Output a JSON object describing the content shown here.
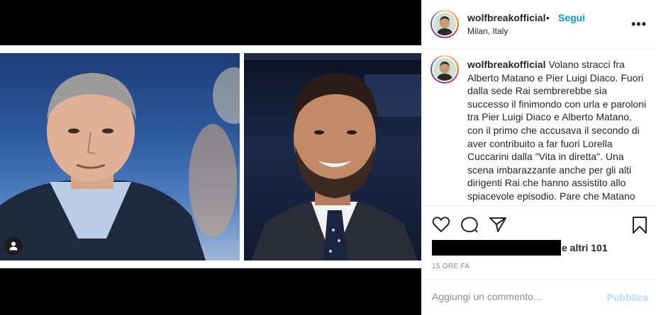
{
  "post": {
    "username": "wolfbreakofficial",
    "separator": "•",
    "follow_label": "Segui",
    "location": "Milan, Italy",
    "more_icon": "more-horizontal-icon",
    "caption_text": "Volano stracci fra Alberto Matano e Pier Luigi Diaco. Fuori dalla sede Rai sembrerebbe sia successo il finimondo con urla e paroloni tra Pier Luigi Diaco e Alberto Matano, con il primo che accusava il secondo di aver contribuito a far fuori Lorella Cuccarini dalla \"Vita in diretta\". Una scena imbarazzante anche per gli alti dirigenti Rai che hanno assistito allo spiacevole episodio. Pare che Matano non abbia risposto agli insulti per",
    "likes_text": "e altri 101",
    "time": "15 ORE FA"
  },
  "comment": {
    "placeholder": "Aggiungi un commento...",
    "publish_label": "Pubblica"
  },
  "icons": {
    "like": "heart-icon",
    "comment": "comment-bubble-icon",
    "share": "paper-plane-icon",
    "save": "bookmark-icon",
    "tag": "user-tag-icon"
  },
  "colors": {
    "accent": "#0095f6",
    "publish_disabled": "#b3dbff",
    "muted": "#8e8e8e"
  }
}
